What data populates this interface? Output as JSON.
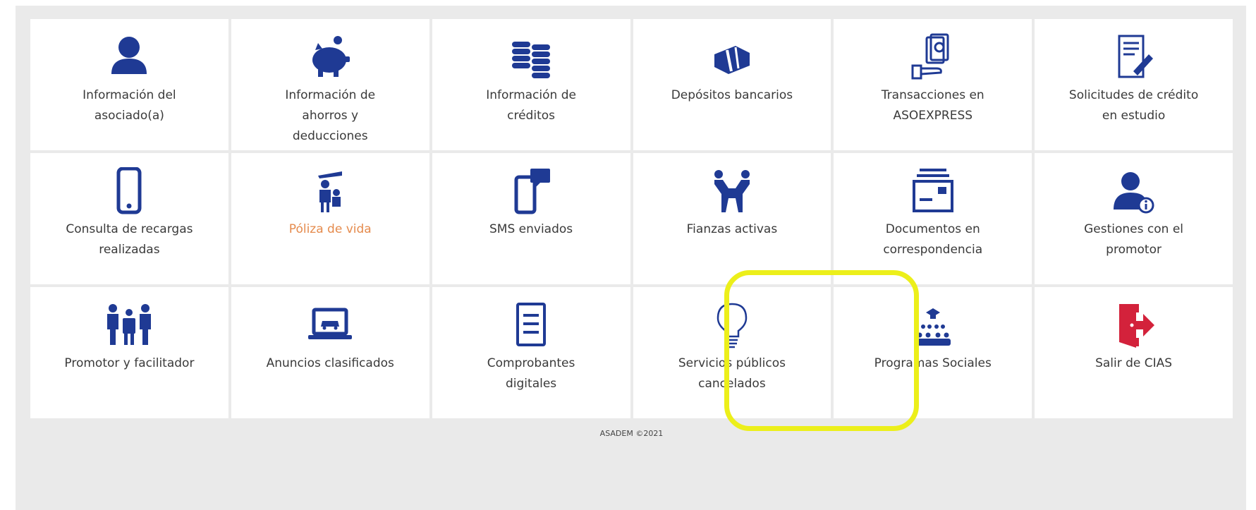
{
  "colors": {
    "icon_blue": "#1f3a94",
    "exit_red": "#d3223b",
    "highlight_yellow": "#ecef1a",
    "label_gray": "#3a3a3a",
    "label_orange": "#e58b4d"
  },
  "tiles": [
    {
      "label": "Información del\nasociado(a)",
      "icon": "person-icon"
    },
    {
      "label": "Información de\nahorros y\ndeducciones",
      "icon": "piggy-bank-icon"
    },
    {
      "label": "Información de\ncréditos",
      "icon": "coins-stack-icon"
    },
    {
      "label": "Depósitos bancarios",
      "icon": "money-bundle-icon"
    },
    {
      "label": "Transacciones en\nASOEXPRESS",
      "icon": "hand-cash-icon"
    },
    {
      "label": "Solicitudes de crédito\nen estudio",
      "icon": "document-sign-icon"
    },
    {
      "label": "Consulta de recargas\nrealizadas",
      "icon": "smartphone-icon"
    },
    {
      "label": "Póliza de vida",
      "icon": "family-protection-icon",
      "accent": "orange"
    },
    {
      "label": "SMS enviados",
      "icon": "phone-message-icon"
    },
    {
      "label": "Fianzas activas",
      "icon": "handshake-icon"
    },
    {
      "label": "Documentos en\ncorrespondencia",
      "icon": "mail-documents-icon"
    },
    {
      "label": "Gestiones con el\npromotor",
      "icon": "agent-info-icon"
    },
    {
      "label": "Promotor y facilitador",
      "icon": "people-meeting-icon"
    },
    {
      "label": "Anuncios clasificados",
      "icon": "laptop-car-icon"
    },
    {
      "label": "Comprobantes\ndigitales",
      "icon": "document-lines-icon"
    },
    {
      "label": "Servicios públicos\ncancelados",
      "icon": "lightbulb-icon"
    },
    {
      "label": "Programas Sociales",
      "icon": "graduation-group-icon",
      "highlighted": true
    },
    {
      "label": "Salir de CIAS",
      "icon": "exit-door-icon"
    }
  ],
  "footer": {
    "copyright": "ASADEM ©2021"
  }
}
